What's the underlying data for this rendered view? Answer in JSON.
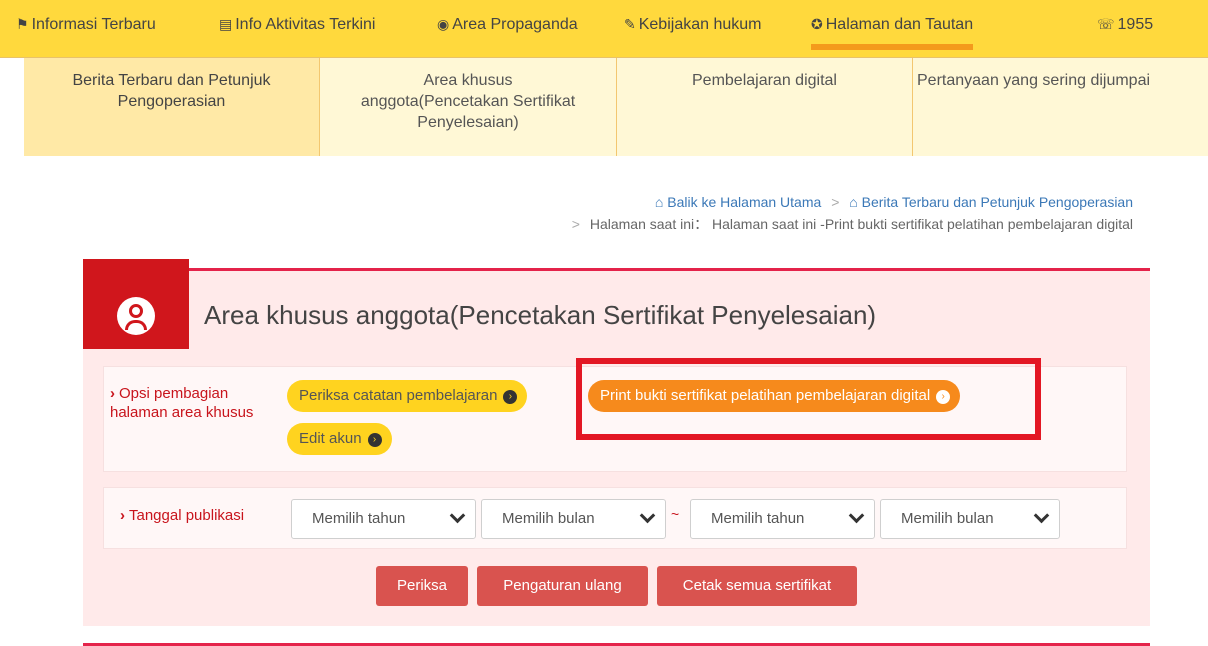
{
  "topnav": {
    "items": [
      {
        "icon": "flag-icon",
        "glyph": "⚑",
        "label": "Informasi Terbaru"
      },
      {
        "icon": "newspaper-icon",
        "glyph": "▤",
        "label": "Info Aktivitas Terkini"
      },
      {
        "icon": "podcast-icon",
        "glyph": "◉",
        "label": "Area Propaganda"
      },
      {
        "icon": "gavel-icon",
        "glyph": "✎",
        "label": "Kebijakan hukum"
      },
      {
        "icon": "lifebuoy-icon",
        "glyph": "✪",
        "label": "Halaman dan Tautan"
      },
      {
        "icon": "whatsapp-icon",
        "glyph": "☏",
        "label": "1955"
      }
    ]
  },
  "categories": [
    {
      "label_lines": [
        "Berita Terbaru dan Petunjuk",
        "Pengoperasian"
      ]
    },
    {
      "label_lines": [
        "Area khusus",
        "anggota(Pencetakan Sertifikat",
        "Penyelesaian)"
      ]
    },
    {
      "label_lines": [
        "Pembelajaran digital"
      ]
    },
    {
      "label_lines": [
        "Pertanyaan yang sering dijumpai"
      ]
    }
  ],
  "breadcrumb": {
    "home": "Balik ke Halaman Utama",
    "section": "Berita Terbaru dan Petunjuk Pengoperasian",
    "current_prefix": "Halaman saat ini：",
    "current": "Halaman saat ini -Print bukti sertifikat pelatihan pembelajaran digital"
  },
  "panel": {
    "title": "Area khusus anggota(Pencetakan Sertifikat Penyelesaian)",
    "options_label": "Opsi pembagian halaman area khusus",
    "options": {
      "check_records": "Periksa catatan pembelajaran",
      "print_certificate": "Print bukti sertifikat pelatihan pembelajaran digital",
      "edit_account": "Edit akun"
    },
    "date_label": "Tanggal publikasi",
    "selects": {
      "from_year": "Memilih tahun",
      "from_month": "Memilih bulan",
      "separator": "~",
      "to_year": "Memilih tahun",
      "to_month": "Memilih bulan"
    },
    "buttons": {
      "check": "Periksa",
      "reset": "Pengaturan ulang",
      "print_all": "Cetak semua sertifikat"
    }
  },
  "colors": {
    "nav_bg": "#ffd93d",
    "accent_red": "#d0161c",
    "pill_yellow": "#ffd31f",
    "pill_orange": "#f68a1c",
    "button_red": "#d9534f"
  }
}
